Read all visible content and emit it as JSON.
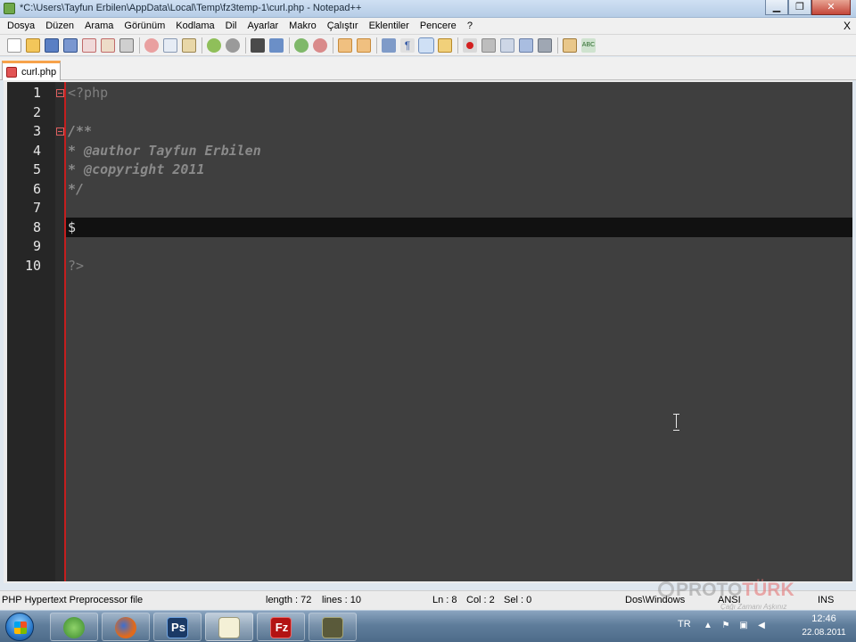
{
  "window": {
    "title": "*C:\\Users\\Tayfun Erbilen\\AppData\\Local\\Temp\\fz3temp-1\\curl.php - Notepad++",
    "minimize_glyph": "▁",
    "maximize_glyph": "❐",
    "close_glyph": "✕"
  },
  "menu": {
    "items": [
      "Dosya",
      "Düzen",
      "Arama",
      "Görünüm",
      "Kodlama",
      "Dil",
      "Ayarlar",
      "Makro",
      "Çalıştır",
      "Eklentiler",
      "Pencere",
      "?"
    ],
    "close_glyph": "X"
  },
  "toolbar": {
    "icons": [
      "new-file-icon",
      "open-file-icon",
      "save-icon",
      "save-all-icon",
      "close-icon",
      "close-all-icon",
      "print-icon",
      "cut-icon",
      "copy-icon",
      "paste-icon",
      "undo-icon",
      "redo-icon",
      "find-icon",
      "replace-icon",
      "zoom-in-icon",
      "zoom-out-icon",
      "sync-vertical-icon",
      "sync-horizontal-icon",
      "word-wrap-icon",
      "show-all-characters-icon",
      "indent-guide-icon",
      "doc-map-icon",
      "record-macro-icon",
      "stop-record-icon",
      "play-macro-icon",
      "run-macro-multiple-icon",
      "save-macro-icon",
      "launch-browser-icon",
      "spell-check-icon"
    ]
  },
  "tab": {
    "label": "curl.php"
  },
  "editor": {
    "current_line": 8,
    "lines": [
      {
        "n": "1",
        "text": "<?php",
        "kind": "php",
        "fold": true
      },
      {
        "n": "2",
        "text": "",
        "kind": "php",
        "fold": false
      },
      {
        "n": "3",
        "text": "/**",
        "kind": "comment",
        "fold": true
      },
      {
        "n": "4",
        "text": "* @author Tayfun Erbilen",
        "kind": "comment",
        "fold": false
      },
      {
        "n": "5",
        "text": "* @copyright 2011",
        "kind": "comment",
        "fold": false
      },
      {
        "n": "6",
        "text": "*/",
        "kind": "comment",
        "fold": false
      },
      {
        "n": "7",
        "text": "",
        "kind": "php",
        "fold": false
      },
      {
        "n": "8",
        "text": "$",
        "kind": "var",
        "fold": false
      },
      {
        "n": "9",
        "text": "",
        "kind": "php",
        "fold": false
      },
      {
        "n": "10",
        "text": "?>",
        "kind": "php",
        "fold": false
      }
    ]
  },
  "status": {
    "file_type": "PHP Hypertext Preprocessor file",
    "length": "length : 72",
    "lines": "lines : 10",
    "ln": "Ln : 8",
    "col": "Col : 2",
    "sel": "Sel : 0",
    "eol": "Dos\\Windows",
    "encoding": "ANSI",
    "mode": "INS"
  },
  "watermark": {
    "brand_a": "PROTO",
    "brand_b": "TÜRK",
    "tagline": "Çağı Zamanı Aşkınız"
  },
  "taskbar": {
    "apps": [
      {
        "name": "ie-explorer-icon",
        "label": ""
      },
      {
        "name": "firefox-icon",
        "label": ""
      },
      {
        "name": "photoshop-icon",
        "label": "Ps"
      },
      {
        "name": "notepadpp-icon",
        "label": ""
      },
      {
        "name": "filezilla-icon",
        "label": "Fz"
      },
      {
        "name": "gimp-icon",
        "label": ""
      }
    ],
    "language": "TR",
    "time": "12:46",
    "date": "22.08.2011"
  }
}
